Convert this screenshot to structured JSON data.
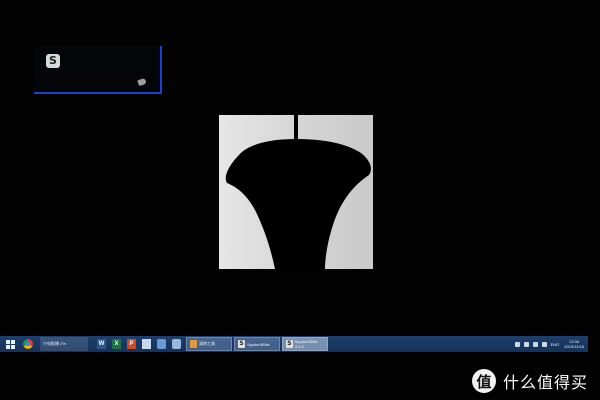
{
  "app_window": {
    "icon_letter": "S",
    "icon_name": "spyder-app-icon"
  },
  "taskbar": {
    "pinned_app_label": "宁电影播 2%",
    "word_letter": "W",
    "excel_letter": "X",
    "ppt_letter": "P",
    "items": [
      {
        "label": "清除工具"
      },
      {
        "label": "Spyder4Elite"
      },
      {
        "label": "Spyder4Elite 4.5.4"
      }
    ],
    "tray_lang": "ENG",
    "clock_time": "13:34",
    "clock_date": "2015/11/16"
  },
  "watermark": {
    "logo_letter": "值",
    "text": "什么值得买"
  },
  "colors": {
    "window_border": "#1f3fd1",
    "taskbar": "#15325a",
    "panel_light": "#d6d6d6",
    "silhouette": "#000000"
  }
}
